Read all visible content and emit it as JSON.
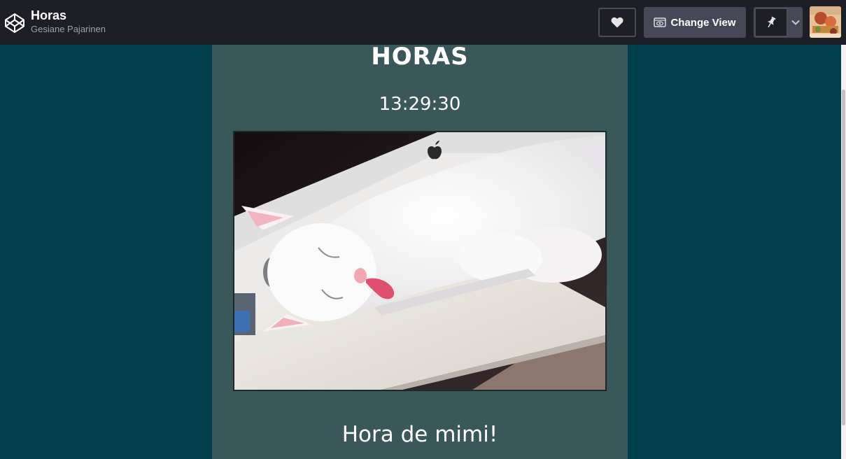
{
  "header": {
    "title": "Horas",
    "author": "Gesiane Pajarinen",
    "change_view_label": "Change View"
  },
  "icons": {
    "logo": "codepen-logo-icon",
    "heart": "heart-icon",
    "change_view": "eye-icon",
    "pin": "pin-icon",
    "dropdown": "chevron-down-icon"
  },
  "colors": {
    "topbar": "#1e1f26",
    "page_background": "#003f4a",
    "card_background": "#3a575a",
    "button": "#444857"
  },
  "content": {
    "heading": "HORAS",
    "time": "13:29:30",
    "caption": "Hora de mimi!"
  }
}
